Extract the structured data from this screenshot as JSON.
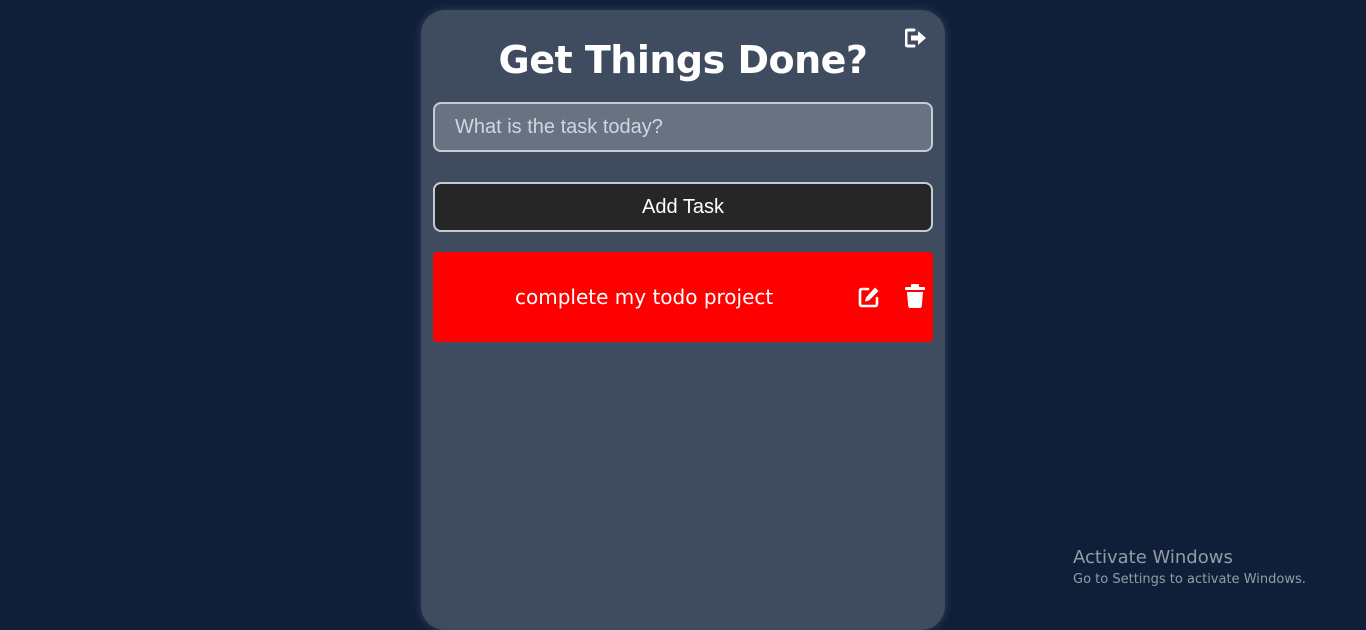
{
  "app": {
    "title": "Get Things Done?",
    "logout_icon": "sign-out-icon"
  },
  "form": {
    "input_value": "",
    "input_placeholder": "What is the task today?",
    "add_button_label": "Add Task"
  },
  "todos": [
    {
      "text": "complete my todo project",
      "background": "#ff0000",
      "actions": [
        "edit-icon",
        "trash-icon"
      ]
    }
  ],
  "colors": {
    "page_background": "#0f1f3a",
    "card_background": "#3f4b5f",
    "input_background": "#687283",
    "button_background": "#262626",
    "todo_background": "#ff0000"
  },
  "watermark": {
    "title": "Activate Windows",
    "subtitle": "Go to Settings to activate Windows."
  }
}
